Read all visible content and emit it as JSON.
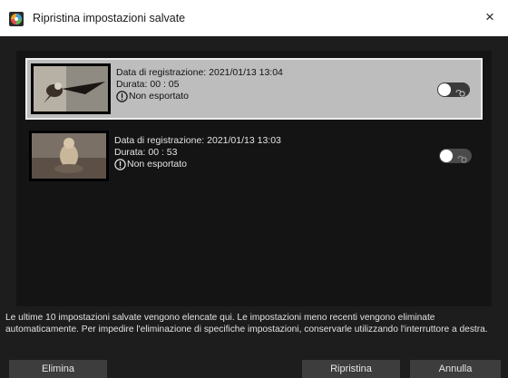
{
  "window": {
    "title": "Ripristina impostazioni salvate",
    "close_label": "×"
  },
  "items": [
    {
      "recorded": "Data di registrazione: 2021/01/13 13:04",
      "duration": "Durata: 00 : 05",
      "status": "Non esportato",
      "protected": false,
      "selected": true,
      "thumbnail": "bird-in-flight"
    },
    {
      "recorded": "Data di registrazione: 2021/01/13 13:03",
      "duration": "Durata: 00 : 53",
      "status": "Non esportato",
      "protected": false,
      "selected": false,
      "thumbnail": "prairie-dog"
    }
  ],
  "footnote": "Le ultime 10 impostazioni salvate vengono elencate qui. Le impostazioni meno recenti vengono eliminate automaticamente. Per impedire l'eliminazione di specifiche impostazioni, conservarle utilizzando l'interruttore a destra.",
  "buttons": {
    "delete": "Elimina",
    "restore": "Ripristina",
    "cancel": "Annulla"
  },
  "icons": {
    "app": "app-icon",
    "close": "close-icon",
    "warning": "exclamation-circle-icon",
    "toggle_lock": "lock-icon"
  },
  "colors": {
    "background": "#1d1d1d",
    "list_background": "#141414",
    "selected_row": "#bdbdbd",
    "button": "#3d3d3d"
  }
}
